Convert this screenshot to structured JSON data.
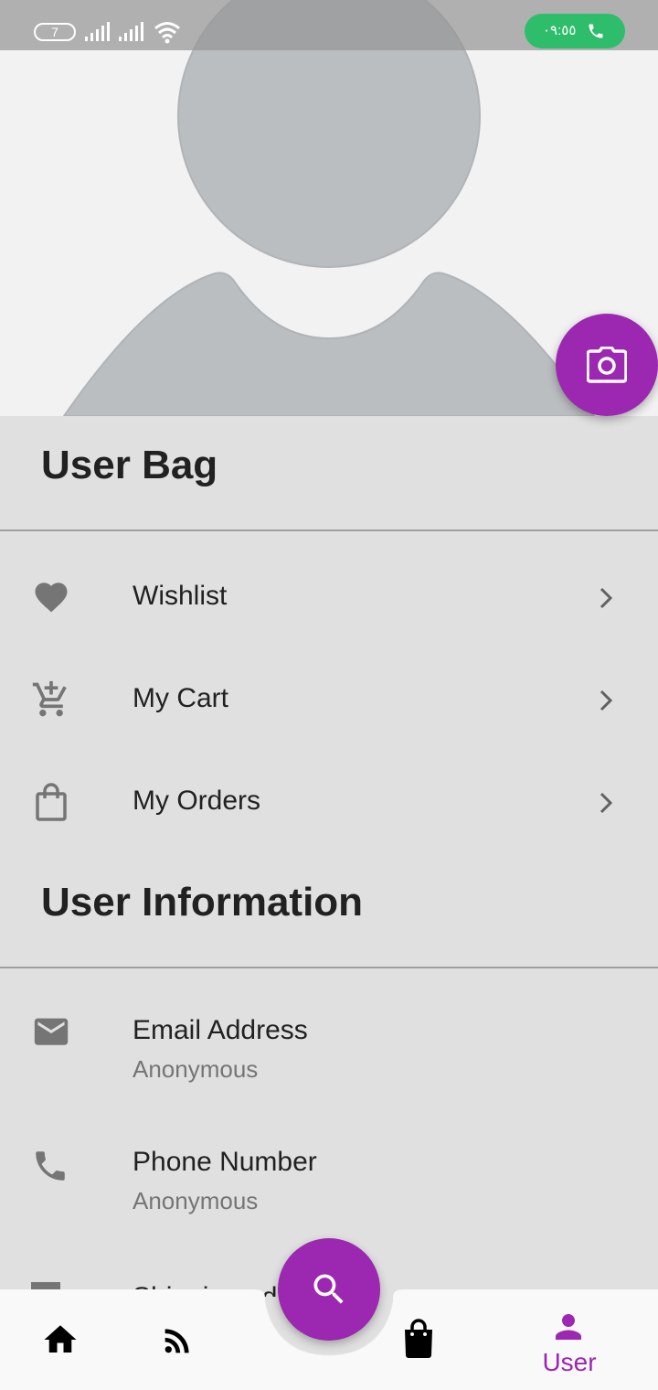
{
  "status_bar": {
    "battery_level": "7",
    "call_time": "٠٩:٥٥",
    "icons": [
      "battery-icon",
      "signal-icon",
      "signal-icon",
      "wifi-icon",
      "phone-icon"
    ]
  },
  "profile": {
    "avatar": "default-avatar-placeholder",
    "camera_button_icon": "camera-icon"
  },
  "user_bag": {
    "title": "User Bag",
    "items": [
      {
        "label": "Wishlist",
        "icon": "heart-icon"
      },
      {
        "label": "My Cart",
        "icon": "add-to-cart-icon"
      },
      {
        "label": "My Orders",
        "icon": "shopping-bag-icon"
      }
    ]
  },
  "user_information": {
    "title": "User Information",
    "items": [
      {
        "label": "Email Address",
        "value": "Anonymous",
        "icon": "email-icon"
      },
      {
        "label": "Phone Number",
        "value": "Anonymous",
        "icon": "phone-icon"
      },
      {
        "label": "Shipping address",
        "icon": "local-shipping-icon"
      }
    ]
  },
  "bottom_nav": {
    "items": [
      {
        "icon": "home-icon"
      },
      {
        "icon": "rss-feed-icon"
      },
      {
        "icon": "shopping-bag-icon"
      },
      {
        "icon": "person-icon",
        "label": "User",
        "active": true
      }
    ],
    "fab_icon": "search-icon"
  },
  "colors": {
    "accent": "#9c27b0",
    "background": "#e0e0e0",
    "header_background": "#f2f2f2",
    "call_pill": "#2ebd6b"
  }
}
